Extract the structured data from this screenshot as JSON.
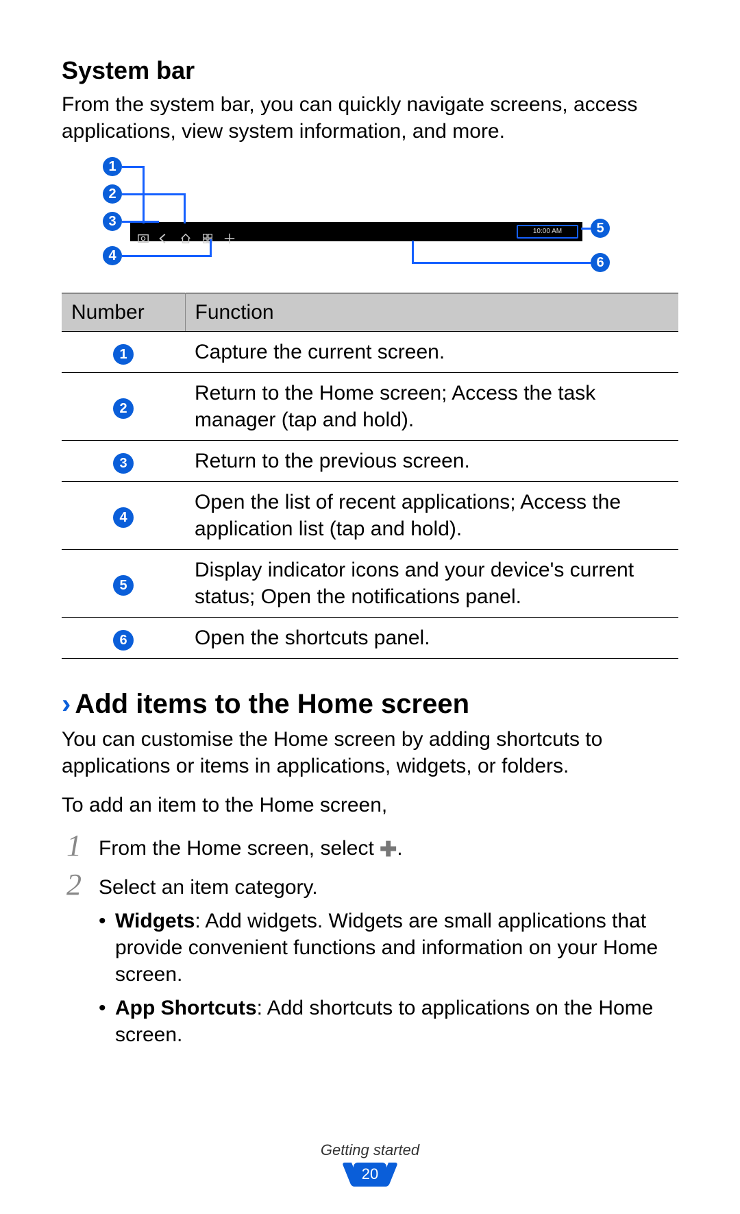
{
  "section1": {
    "title": "System bar",
    "intro": "From the system bar, you can quickly navigate screens, access applications, view system information, and more."
  },
  "diagram": {
    "time": "10:00 AM"
  },
  "table": {
    "headers": {
      "number": "Number",
      "function": "Function"
    },
    "rows": [
      {
        "n": "1",
        "fn": "Capture the current screen."
      },
      {
        "n": "2",
        "fn": "Return to the Home screen; Access the task manager (tap and hold)."
      },
      {
        "n": "3",
        "fn": "Return to the previous screen."
      },
      {
        "n": "4",
        "fn": "Open the list of recent applications; Access the application list (tap and hold)."
      },
      {
        "n": "5",
        "fn": "Display indicator icons and your device's current status; Open the notifications panel."
      },
      {
        "n": "6",
        "fn": "Open the shortcuts panel."
      }
    ]
  },
  "section2": {
    "title": "Add items to the Home screen",
    "p1": "You can customise the Home screen by adding shortcuts to applications or items in applications, widgets, or folders.",
    "p2": "To add an item to the Home screen,",
    "steps": [
      {
        "num": "1",
        "text_before": "From the Home screen, select ",
        "text_after": "."
      },
      {
        "num": "2",
        "text": "Select an item category.",
        "bullets": [
          {
            "label": "Widgets",
            "rest": ": Add widgets. Widgets are small applications that provide convenient functions and information on your Home screen."
          },
          {
            "label": "App Shortcuts",
            "rest": ": Add shortcuts to applications on the Home screen."
          }
        ]
      }
    ]
  },
  "footer": {
    "chapter": "Getting started",
    "page": "20"
  }
}
